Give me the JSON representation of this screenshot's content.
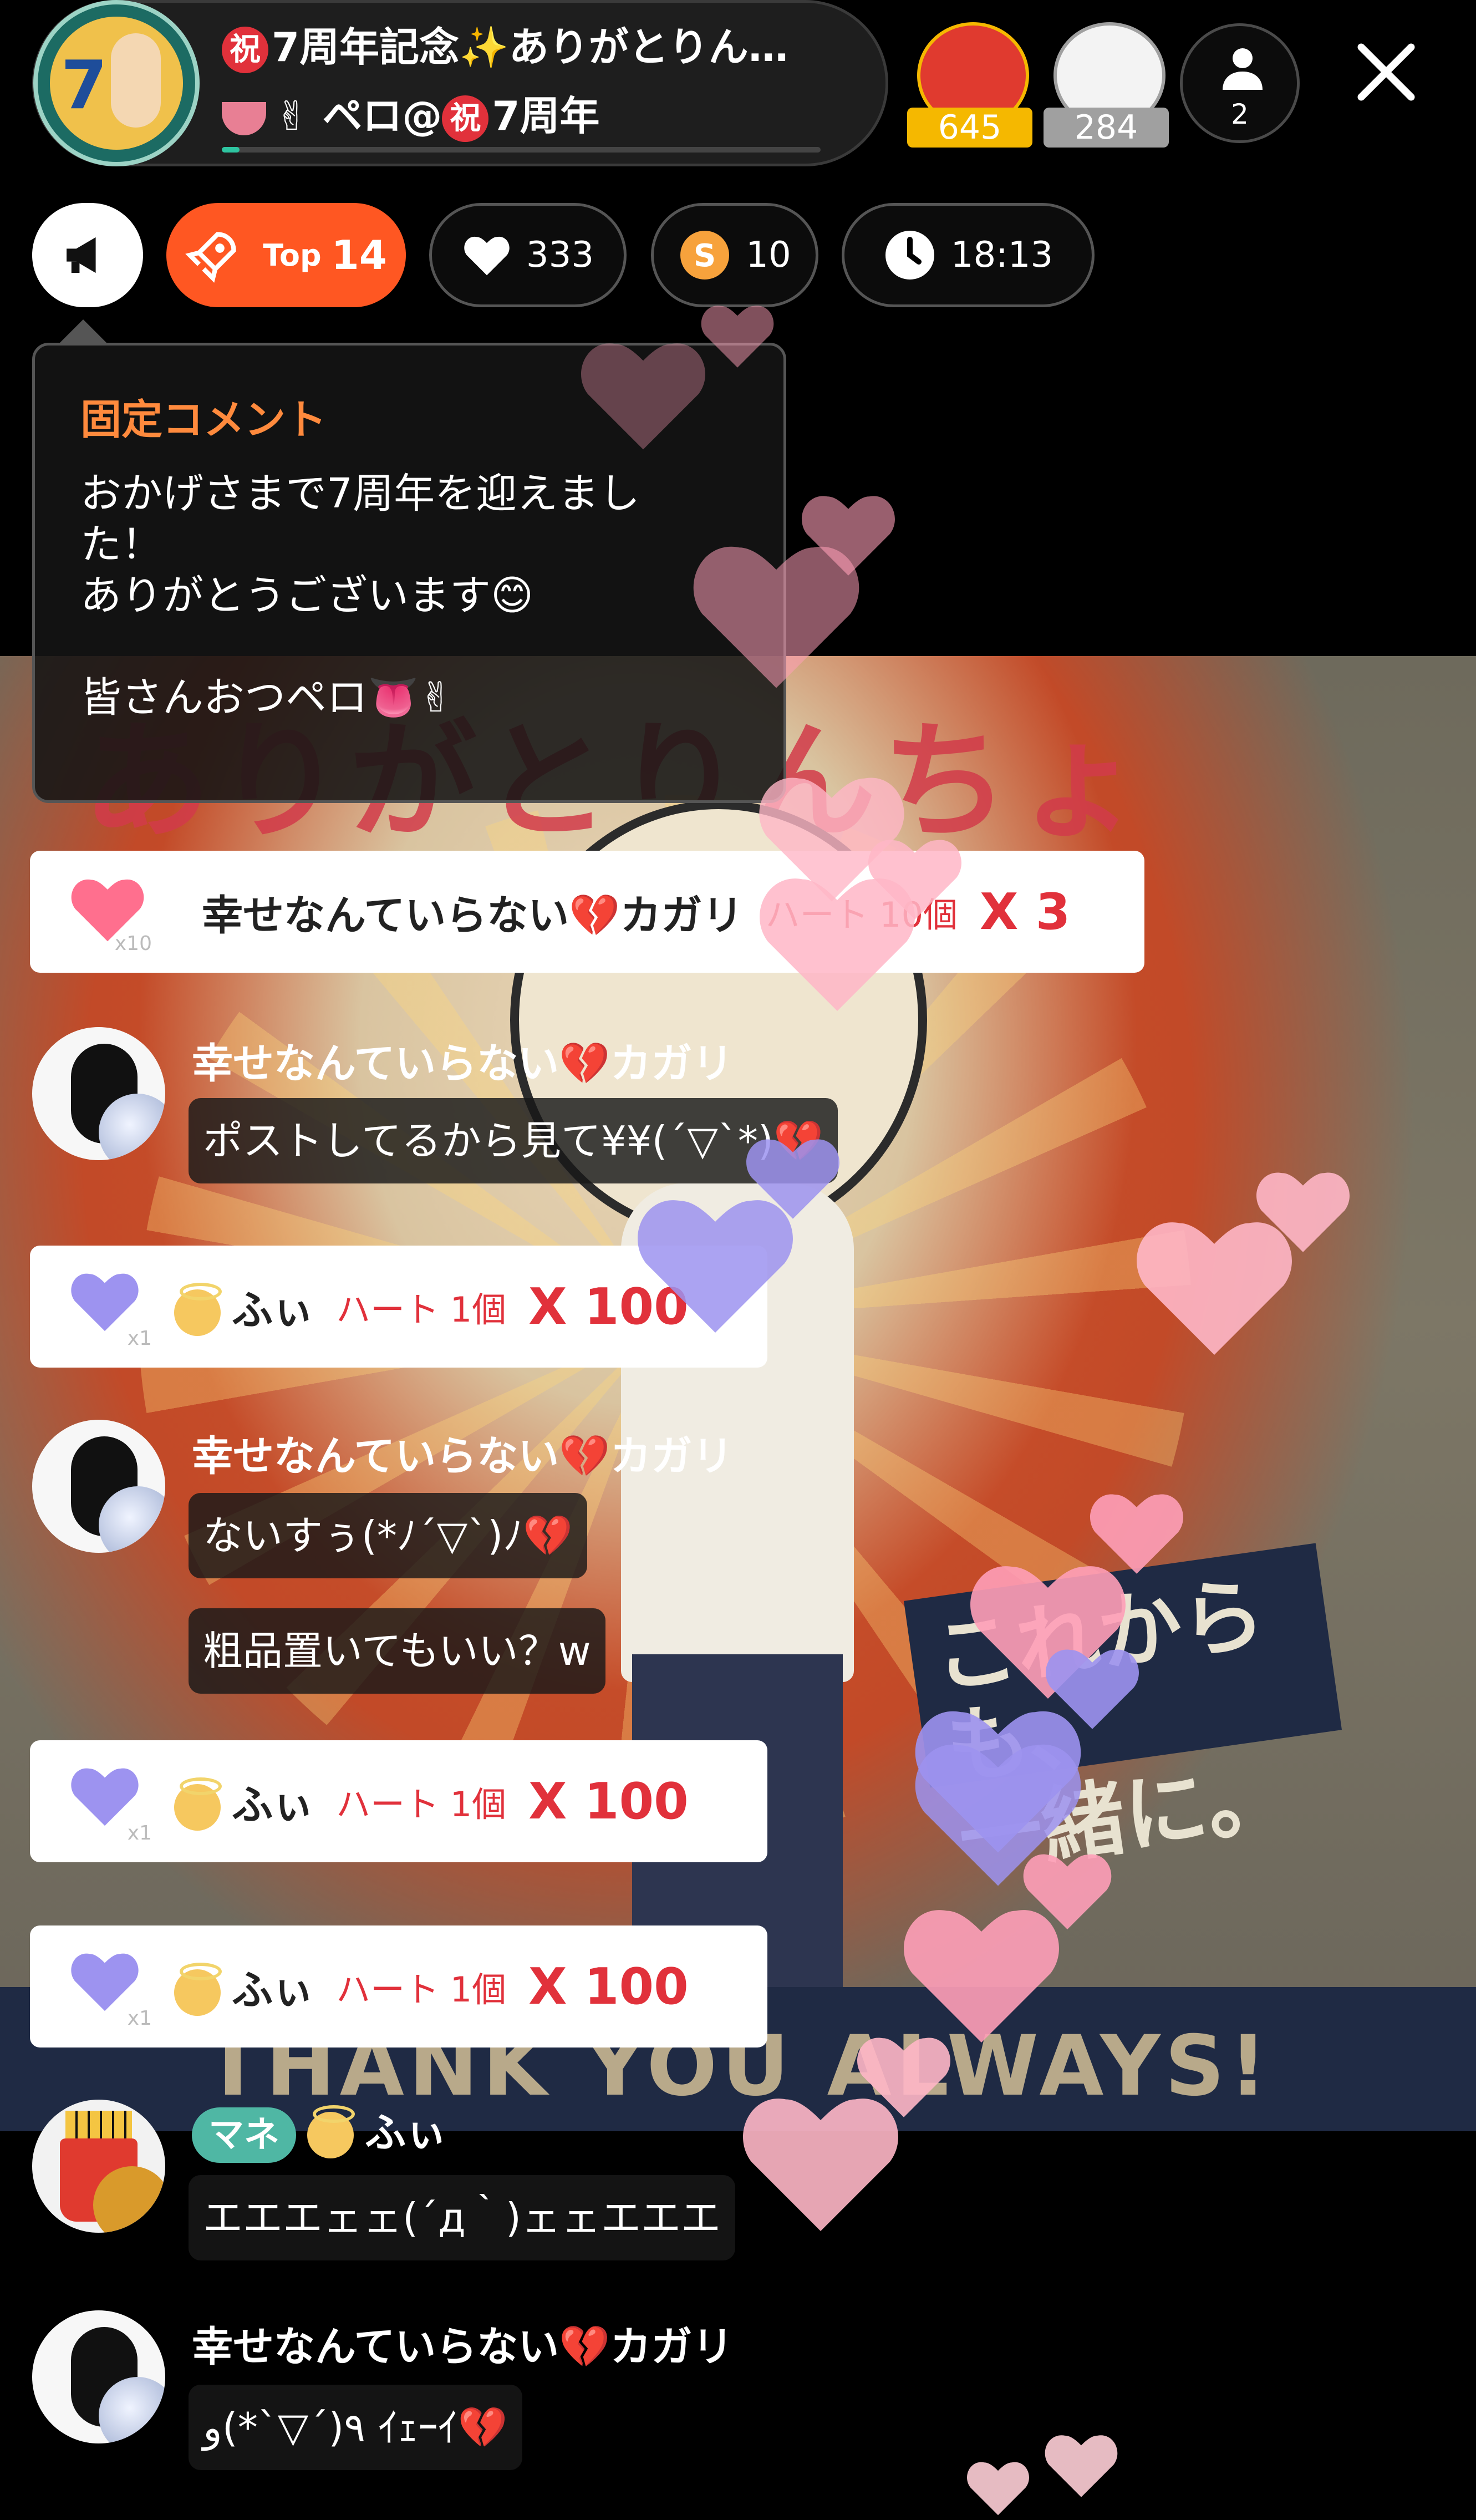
{
  "header": {
    "title": "7周年記念✨ありがとりん…",
    "title_badge": "祝",
    "subtitle_prefix": "✌",
    "subtitle_name": "ペロ@",
    "subtitle_badge": "祝",
    "subtitle_suffix": "7周年",
    "progress": 0.03,
    "rank1_count": "645",
    "rank2_count": "284",
    "viewer_count": "2",
    "rank1_color": "#f5b800",
    "rank2_color": "#a0a0a0"
  },
  "toolbar": {
    "top_label": "Top",
    "top_value": "14",
    "likes": "333",
    "coins": "10",
    "time": "18:13",
    "accent": "#ff5722"
  },
  "pinned": {
    "label": "固定コメント",
    "line1": "おかげさまで7周年を迎えまし",
    "line2": "た！",
    "line3": "ありがとうございます😊",
    "line4": "皆さんおつペロ👅✌"
  },
  "gifts": [
    {
      "name": "幸せなんていらない💔カガリ",
      "item": "ハート 10個",
      "count": "X 3",
      "multiplier": "x10"
    },
    {
      "name": "ふぃ",
      "item": "ハート 1個",
      "count": "X 100",
      "multiplier": "x1"
    },
    {
      "name": "ふぃ",
      "item": "ハート 1個",
      "count": "X 100",
      "multiplier": "x1"
    },
    {
      "name": "ふぃ",
      "item": "ハート 1個",
      "count": "X 100",
      "multiplier": "x1"
    }
  ],
  "messages": [
    {
      "name": "幸せなんていらない💔カガリ",
      "texts": [
        "ポストしてるから見て¥¥(´▽`*)💔"
      ]
    },
    {
      "name": "幸せなんていらない💔カガリ",
      "texts": [
        "ないすぅ(*ﾉ´▽`)ﾉ💔",
        "粗品置いてもいい？w"
      ]
    },
    {
      "tag": "マネ",
      "name": "ふぃ",
      "texts": [
        "エエエェェ(´д｀)ェェエエエ"
      ]
    },
    {
      "name": "幸せなんていらない💔カガリ",
      "texts": [
        "٩(´▽`*)و ｲｪｰｲ💔"
      ]
    }
  ],
  "stream": {
    "banner": "ありがとりんちょ",
    "side_text_1": "これからも、",
    "side_text_2": "一緒に。",
    "footer": "THANK YOU ALWAYS!"
  },
  "icons": [
    "megaphone-icon",
    "rocket-icon",
    "heart-icon",
    "coin-icon",
    "clock-icon",
    "user-icon",
    "close-icon"
  ],
  "colors": {
    "heart_pink": "#ff9fb8",
    "heart_purple": "#9d93f0",
    "gift_red": "#e1313b",
    "mane_tag": "#4fb7a4"
  }
}
